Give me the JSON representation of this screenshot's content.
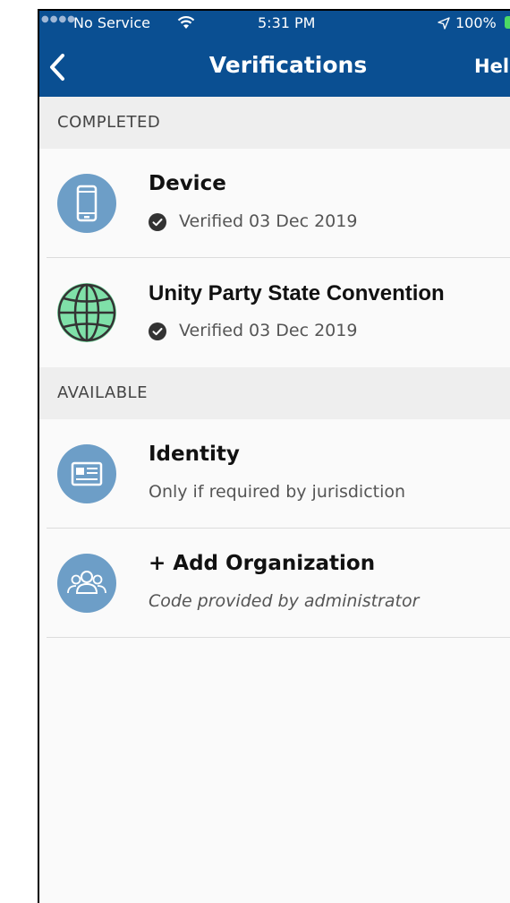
{
  "status_bar": {
    "carrier": "No Service",
    "time": "5:31 PM",
    "battery": "100%"
  },
  "nav": {
    "title": "Verifications",
    "help_label": "Help"
  },
  "sections": {
    "completed": {
      "header": "COMPLETED",
      "items": [
        {
          "icon": "mobile-phone-icon",
          "title": "Device",
          "status": "Verified 03 Dec 2019"
        },
        {
          "icon": "globe-icon",
          "title": "Unity Party State Convention",
          "status": "Verified 03 Dec 2019"
        }
      ]
    },
    "available": {
      "header": "AVAILABLE",
      "items": [
        {
          "icon": "id-card-icon",
          "title": "Identity",
          "subtitle": "Only if required by jurisdiction"
        },
        {
          "icon": "group-icon",
          "title": "+ Add Organization",
          "subtitle": "Code provided by administrator"
        }
      ]
    }
  },
  "colors": {
    "nav_blue": "#0a4f92",
    "icon_blue": "#6d9ec7",
    "globe_green": "#7fe0a8",
    "battery_green": "#4cd964"
  }
}
